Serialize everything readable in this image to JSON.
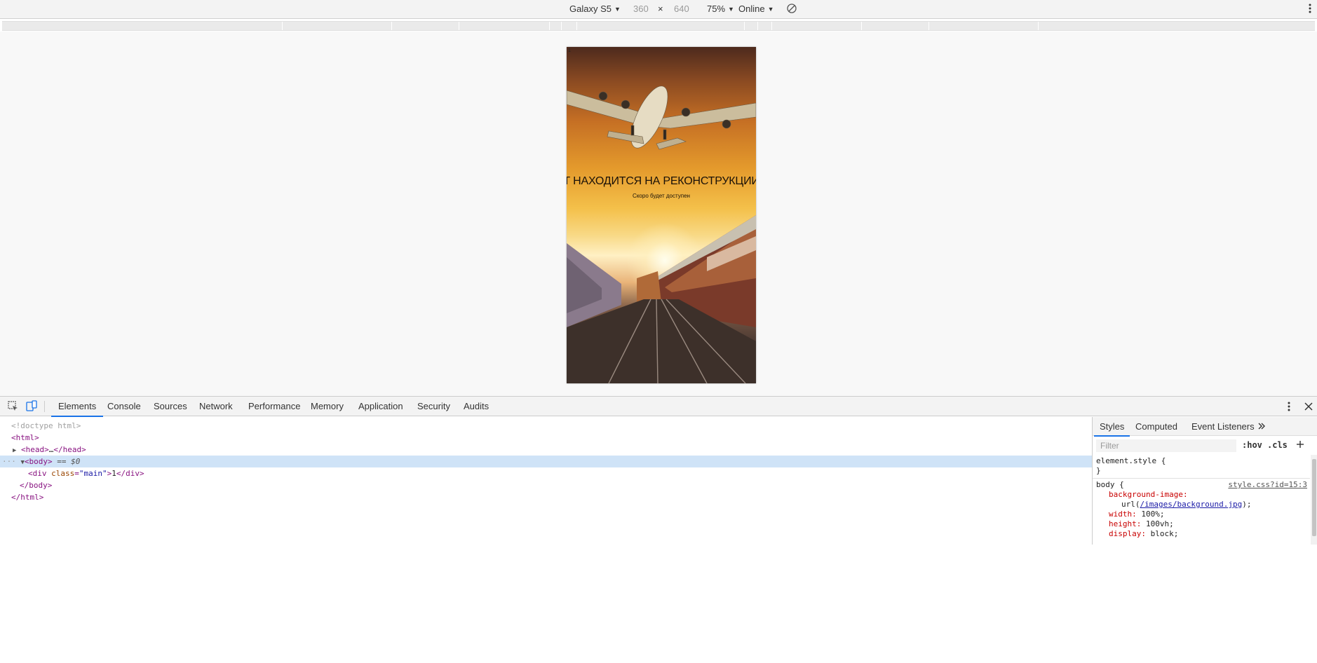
{
  "device_toolbar": {
    "device_name": "Galaxy S5",
    "width": "360",
    "times": "×",
    "height": "640",
    "zoom": "75%",
    "network": "Online",
    "caret": "▼"
  },
  "site": {
    "heading": "Т НАХОДИТСЯ НА РЕКОНСТРУКЦИИ",
    "subheading": "Скоро будет доступен"
  },
  "devtools": {
    "tabs": [
      "Elements",
      "Console",
      "Sources",
      "Network",
      "Performance",
      "Memory",
      "Application",
      "Security",
      "Audits"
    ],
    "active_tab": "Elements",
    "tree": {
      "doctype": "<!doctype html>",
      "html_open": "<html>",
      "head_open": "<head>",
      "head_ellipsis": "…",
      "head_close": "</head>",
      "body_open": "<body>",
      "body_marker": "== $0",
      "div_open_tag": "<div",
      "div_attr_name": "class",
      "div_attr_value": "\"main\"",
      "div_text": "1",
      "div_close": "</div>",
      "body_close": "</body>",
      "html_close": "</html>",
      "dots": "···"
    },
    "styles": {
      "tabs": [
        "Styles",
        "Computed",
        "Event Listeners"
      ],
      "filter_placeholder": "Filter",
      "hov": ":hov",
      "cls": ".cls",
      "element_style_open": "element.style {",
      "element_style_close": "}",
      "body_selector": "body {",
      "source": "style.css?id=15:3",
      "decl_bg_prop": "background-image:",
      "decl_bg_url_prefix": "url(",
      "decl_bg_url": "/images/background.jpg",
      "decl_bg_url_suffix": ");",
      "decl_width_prop": "width:",
      "decl_width_val": " 100%;",
      "decl_height_prop": "height:",
      "decl_height_val": " 100vh;",
      "decl_display_prop": "display:",
      "decl_display_val": " block;"
    }
  },
  "icons": {
    "rotate": "rotate-icon",
    "more": "more-vertical-icon",
    "inspect": "inspect-element-icon",
    "device_toggle": "device-toggle-icon",
    "close": "close-icon",
    "chevron": "double-chevron-icon",
    "plus": "plus-icon"
  },
  "colors": {
    "accent": "#1a73e8",
    "selection": "#cfe3f7",
    "tag": "#881280",
    "attr_name": "#994500",
    "attr_value": "#1a1aa6",
    "css_prop": "#c80000"
  }
}
